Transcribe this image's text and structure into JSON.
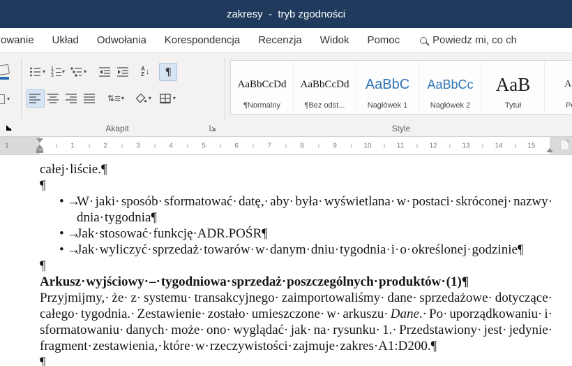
{
  "colors": {
    "titlebar_bg": "#1f3a5c",
    "ribbon_bg": "#f3f2f1",
    "heading_style_blue": "#2e74b5",
    "selected_button_bg": "#d6e4f4"
  },
  "title_bar": {
    "title": "zakresy  -  tryb zgodności"
  },
  "ribbon_tabs": {
    "partial": "owanie",
    "items": [
      "Układ",
      "Odwołania",
      "Korespondencja",
      "Recenzja",
      "Widok",
      "Pomoc"
    ],
    "search_text": "Powiedz mi, co ch"
  },
  "icons": {
    "chevron_down": "▾",
    "pilcrow": "¶",
    "sort_a": "A",
    "sort_z": "Z",
    "arrow_down": "↓",
    "updown": "⇅",
    "lines": "≡",
    "num1": "1",
    "num2": "2",
    "num3": "3"
  },
  "ribbon": {
    "paragraph_group": {
      "label": "Akapit"
    },
    "styles_group": {
      "label": "Style",
      "items": [
        {
          "preview": "AaBbCcDd",
          "name": "¶Normalny"
        },
        {
          "preview": "AaBbCcDd",
          "name": "¶Bez odst..."
        },
        {
          "preview": "AaBbC",
          "name": "Nagłówek 1"
        },
        {
          "preview": "AaBbCc",
          "name": "Nagłówek 2"
        },
        {
          "preview": "AaB",
          "name": "Tytuł"
        },
        {
          "preview": "AaBb",
          "name": "Pod..."
        }
      ]
    }
  },
  "ruler": {
    "margin_number": "1",
    "numbers": [
      "1",
      "2",
      "3",
      "4",
      "5",
      "6",
      "7",
      "8",
      "9",
      "10",
      "11",
      "12",
      "13",
      "14",
      "15"
    ]
  },
  "document": {
    "pilcrow": "¶",
    "bullet_char": "•",
    "tab_char": "→",
    "line1": "całej· liście.¶",
    "bullets": [
      "W· jaki· sposób· sformatować· datę,· aby· była· wyświetlana· w· postaci· skróconej· nazwy· dnia· tygodnia¶",
      "Jak· stosować· funkcję· ADR.POŚR¶",
      "Jak· wyliczyć· sprzedaż· towarów· w· danym· dniu· tygodnia· i· o· określonej· godzinie¶"
    ],
    "heading": "Arkusz· wyjściowy· –· tygodniowa· sprzedaż· poszczególnych· produktów· (1)¶",
    "para": {
      "part1": "Przyjmijmy,· że· z· systemu· transakcyjnego· zaimportowaliśmy· dane· sprzedażowe· dotyczące· całego· tygodnia.· Zestawienie· zostało· umieszczone· w· arkuszu· ",
      "italic": "Dane",
      "part2": ".· Po· uporządkowaniu· i· sformatowaniu· danych· może· ono· wyglądać· jak· na· rysunku· 1.· Przedstawiony· jest· jedynie· fragment· zestawienia,· które· w· rzeczywistości· zajmuje· zakres· A1:D200.¶"
    }
  }
}
